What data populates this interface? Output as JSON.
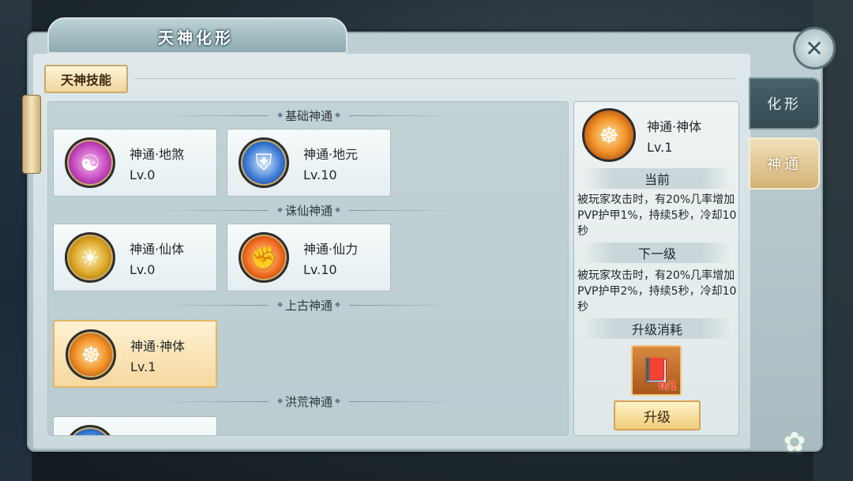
{
  "window": {
    "title": "天神化形",
    "close_icon": "close-icon"
  },
  "side_tabs": [
    {
      "label": "化形",
      "active": false
    },
    {
      "label": "神通",
      "active": true
    }
  ],
  "header_button": "天神技能",
  "sections": [
    {
      "title": "基础神通"
    },
    {
      "title": "诛仙神通"
    },
    {
      "title": "上古神通"
    },
    {
      "title": "洪荒神通"
    }
  ],
  "skills": [
    {
      "name": "神通·地煞",
      "level": "Lv.0",
      "icon": "demon-icon",
      "color": "#c143bd"
    },
    {
      "name": "神通·地元",
      "level": "Lv.10",
      "icon": "wolf-shield-icon",
      "color": "#3877d3"
    },
    {
      "name": "神通·仙体",
      "level": "Lv.0",
      "icon": "immortal-icon",
      "color": "#d9a21f"
    },
    {
      "name": "神通·仙力",
      "level": "Lv.10",
      "icon": "muscle-icon",
      "color": "#ef6a1c"
    },
    {
      "name": "神通·神体",
      "level": "Lv.1",
      "icon": "meditation-icon",
      "color": "#f19127",
      "selected": true
    }
  ],
  "detail": {
    "name": "神通·神体",
    "level": "Lv.1",
    "current_label": "当前",
    "current_desc": "被玩家攻击时，有20%几率增加PVP护甲1%，持续5秒，冷却10秒",
    "next_label": "下一级",
    "next_desc": "被玩家攻击时，有20%几率增加PVP护甲2%，持续5秒，冷却10秒",
    "cost_label": "升级消耗",
    "cost_item_icon": "book-icon",
    "cost_count": "0/1",
    "upgrade_label": "升级"
  }
}
